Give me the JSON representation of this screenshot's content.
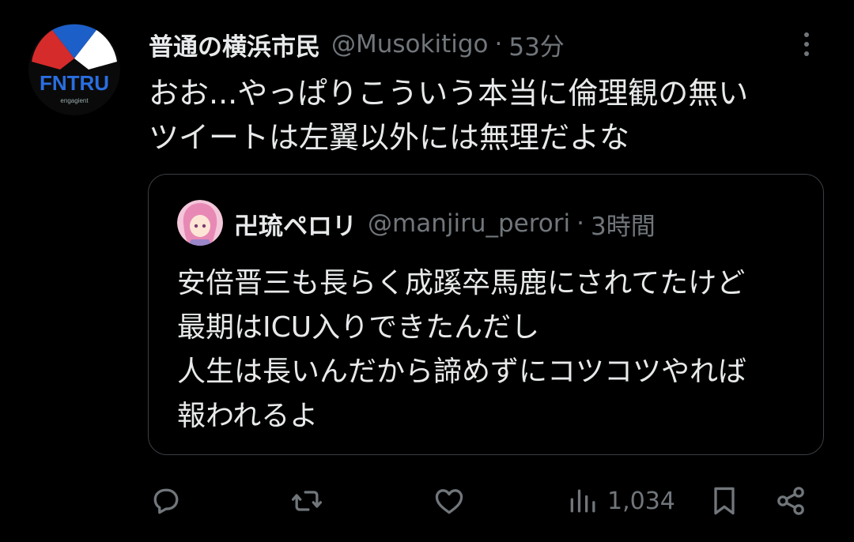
{
  "tweet": {
    "author_name": "普通の横浜市民",
    "author_handle": "@Musokitigo",
    "separator": "·",
    "time": "53分",
    "text_lines": [
      "おお...やっぱりこういう本当に倫理観の無い",
      "ツイートは左翼以外には無理だよな"
    ],
    "avatar_text": "FNTRU",
    "avatar_subtext": "engagient"
  },
  "quoted": {
    "author_name": "卍琉ペロリ",
    "author_handle": "@manjiru_perori",
    "separator": "·",
    "time": "3時間",
    "text_lines": [
      "安倍晋三も長らく成蹊卒馬鹿にされてたけど",
      "最期はICU入りできたんだし",
      "人生は長いんだから諦めずにコツコツやれば",
      "報われるよ"
    ]
  },
  "actions": {
    "views": "1,034"
  },
  "icons": {
    "reply": "reply-icon",
    "retweet": "retweet-icon",
    "like": "like-icon",
    "views": "views-icon",
    "bookmark": "bookmark-icon",
    "share": "share-icon",
    "more": "more-icon"
  },
  "colors": {
    "background": "#000000",
    "text": "#e7e9ea",
    "muted": "#71767b",
    "border": "#3a3f44"
  }
}
